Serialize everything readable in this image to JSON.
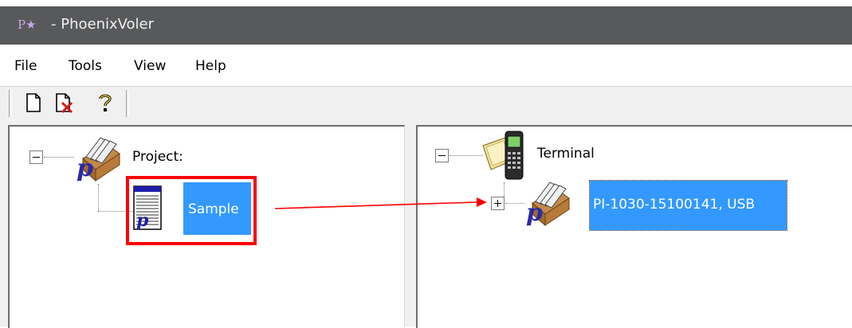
{
  "window": {
    "title": "- PhoenixVoler",
    "icon_glyph": "P★"
  },
  "menu": {
    "items": [
      "File",
      "Tools",
      "View",
      "Help"
    ]
  },
  "toolbar": {
    "buttons": [
      "new-file-icon",
      "delete-file-icon",
      "help-icon"
    ]
  },
  "project_tree": {
    "root_label": "Project:",
    "children": [
      {
        "label": "Sample",
        "selected": true
      }
    ]
  },
  "terminal_tree": {
    "root_label": "Terminal",
    "children": [
      {
        "label": "PI-1030-15100141, USB",
        "selected": true,
        "collapsed": true
      }
    ]
  },
  "annotation": {
    "highlight_color": "#ff0000",
    "arrow_color": "#ff0000"
  },
  "colors": {
    "selection": "#3399ff",
    "titlebar": "#58595b"
  }
}
